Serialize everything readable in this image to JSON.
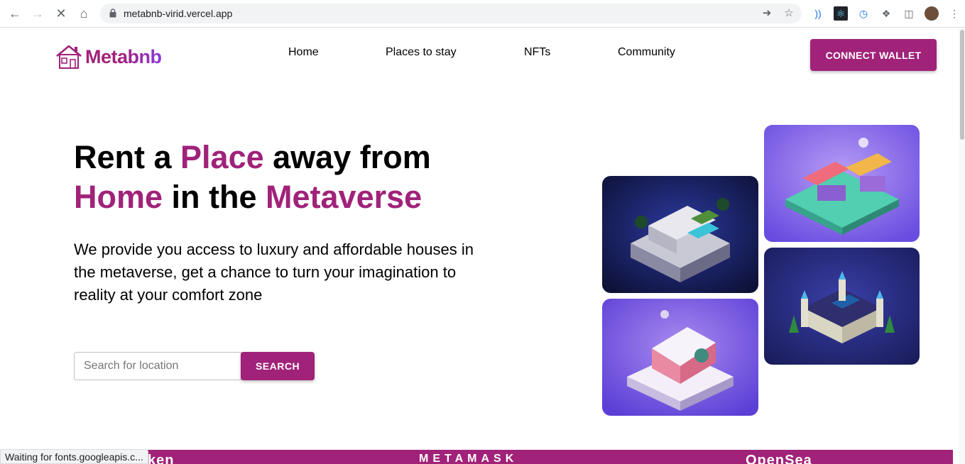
{
  "browser": {
    "url": "metabnb-virid.vercel.app",
    "status_text": "Waiting for fonts.googleapis.c..."
  },
  "nav": {
    "logo_text": "Metabnb",
    "links": [
      "Home",
      "Places to stay",
      "NFTs",
      "Community"
    ],
    "connect_label": "CONNECT WALLET"
  },
  "hero": {
    "headline": {
      "part1": "Rent a ",
      "accent1": "Place",
      "part2": " away from",
      "accent2": "Home",
      "part3": " in the ",
      "accent3": "Metaverse"
    },
    "subtext": "We provide you access to luxury and affordable houses in the metaverse, get a chance to turn your imagination to reality at your comfort zone",
    "search": {
      "placeholder": "Search for location",
      "button_label": "SEARCH"
    }
  },
  "banner": {
    "logos": [
      "MBToken",
      "METAMASK",
      "OpenSea"
    ]
  },
  "colors": {
    "brand": "#A02279",
    "brand_purple": "#8C3BD9"
  }
}
